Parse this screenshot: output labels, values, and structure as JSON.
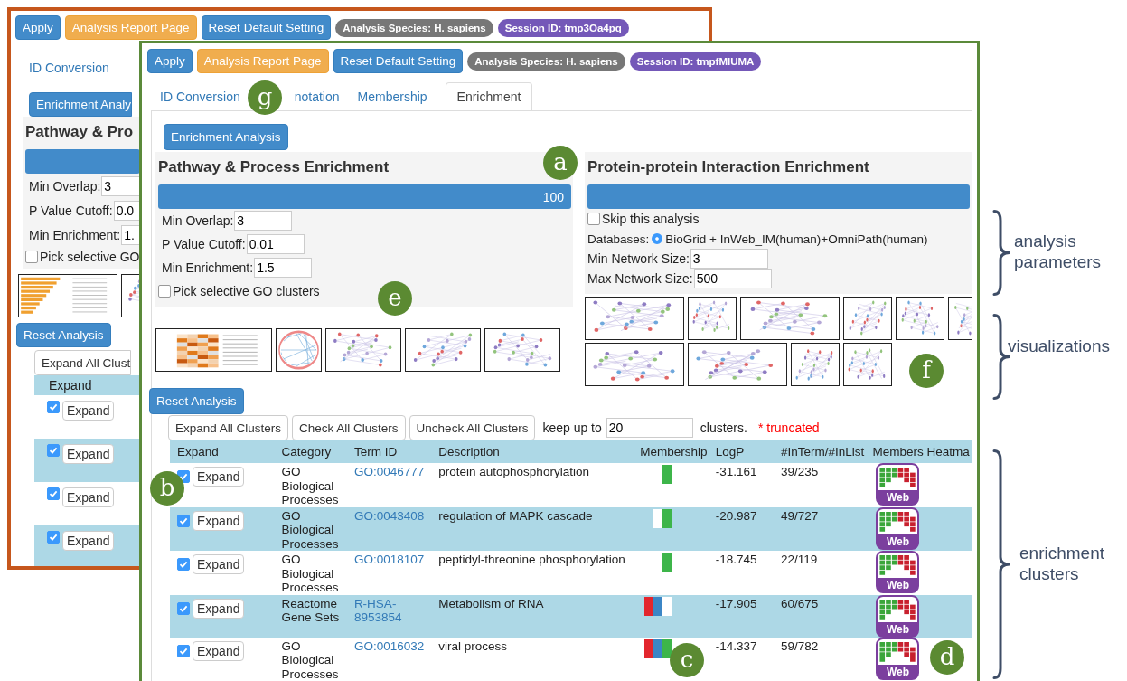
{
  "back_window": {
    "toolbar": {
      "buttons": [
        {
          "label": "Apply",
          "kind": "primary"
        },
        {
          "label": "Analysis Report Page",
          "kind": "warning"
        },
        {
          "label": "Reset Default Setting",
          "kind": "primary"
        }
      ],
      "badges": [
        {
          "label": "Analysis Species: H. sapiens",
          "color": "#777777"
        },
        {
          "label": "Session ID: tmp3Oa4pq",
          "color": "#7458b8"
        }
      ]
    },
    "tabs": [
      {
        "label": "ID Conversion",
        "selected": false
      }
    ],
    "enrichment_button": "Enrichment Analy",
    "heading": "Pathway & Pro",
    "progress": {
      "level": 1
    },
    "fields": [
      {
        "label": "Min Overlap:",
        "value": "3"
      },
      {
        "label": "P Value Cutoff:",
        "value": "0.0"
      },
      {
        "label": "Min Enrichment:",
        "value": "1."
      }
    ],
    "pick_clusters": {
      "label": "Pick selective GO",
      "checked": false
    },
    "thumbnails": [
      {
        "kind": "bar"
      },
      {
        "kind": "network"
      }
    ],
    "reset_button": "Reset Analysis",
    "expand_all_button": "Expand All Clust",
    "table": {
      "columns": [
        "Expand"
      ],
      "rows": [
        {
          "checked": true,
          "button": "Expand"
        },
        {
          "checked": true,
          "button": "Expand"
        },
        {
          "checked": true,
          "button": "Expand"
        },
        {
          "checked": true,
          "button": "Expand"
        }
      ]
    }
  },
  "front_window": {
    "toolbar": {
      "buttons": [
        {
          "label": "Apply",
          "kind": "primary"
        },
        {
          "label": "Analysis Report Page",
          "kind": "warning"
        },
        {
          "label": "Reset Default Setting",
          "kind": "primary"
        }
      ],
      "badges": [
        {
          "label": "Analysis Species: H. sapiens",
          "color": "#777777"
        },
        {
          "label": "Session ID: tmpfMIUMA",
          "color": "#7458b8"
        }
      ]
    },
    "tabs": [
      {
        "label": "ID Conversion",
        "selected": false
      },
      {
        "label": "notation",
        "selected": false
      },
      {
        "label": "Membership",
        "selected": false
      },
      {
        "label": "Enrichment",
        "selected": true
      }
    ],
    "enrichment_button": "Enrichment Analysis",
    "pathway_panel": {
      "heading": "Pathway & Process Enrichment",
      "progress": {
        "level": 1,
        "reading": "100"
      },
      "fields": [
        {
          "label": "Min Overlap:",
          "value": "3"
        },
        {
          "label": "P Value Cutoff:",
          "value": "0.01"
        },
        {
          "label": "Min Enrichment:",
          "value": "1.5"
        }
      ],
      "pick_clusters": {
        "label": "Pick selective GO clusters",
        "checked": false
      },
      "thumbnails": [
        {
          "kind": "heatmap"
        },
        {
          "kind": "circos"
        },
        {
          "kind": "network"
        },
        {
          "kind": "network"
        },
        {
          "kind": "network"
        }
      ]
    },
    "ppi_panel": {
      "heading": "Protein-protein Interaction Enrichment",
      "progress": {
        "level": 1
      },
      "skip": {
        "label": "Skip this analysis",
        "checked": false
      },
      "databases": {
        "label": "Databases:",
        "options": [
          {
            "label": "BioGrid + InWeb_IM(human)+OmniPath(human)",
            "selected": true
          }
        ]
      },
      "fields": [
        {
          "label": "Min Network Size:",
          "value": "3"
        },
        {
          "label": "Max Network Size:",
          "value": "500"
        }
      ],
      "thumbnail_rows": [
        [
          {
            "kind": "network"
          },
          {
            "kind": "cluster"
          },
          {
            "kind": "network"
          },
          {
            "kind": "cluster"
          },
          {
            "kind": "cluster"
          },
          {
            "kind": "cluster"
          }
        ],
        [
          {
            "kind": "network"
          },
          {
            "kind": "network"
          },
          {
            "kind": "cluster"
          },
          {
            "kind": "cluster"
          }
        ]
      ]
    },
    "reset_button": "Reset Analysis",
    "cluster_buttons": [
      "Expand All Clusters",
      "Check All Clusters",
      "Uncheck All Clusters"
    ],
    "keep": {
      "prefix": "keep up to",
      "value": "20",
      "suffix": "clusters.",
      "note": "* truncated"
    },
    "table": {
      "columns": [
        "Expand",
        "Category",
        "Term ID",
        "Description",
        "Membership",
        "LogP",
        "#InTerm/#InList",
        "Members Heatma"
      ],
      "rows": [
        {
          "checked": true,
          "button": "Expand",
          "category": "GO Biological Processes",
          "term_id": "GO:0046777",
          "description": "protein autophosphorylation",
          "membership": [
            {
              "color": "#3db54a"
            }
          ],
          "logp": "-31.161",
          "counts": "39/235",
          "heatmap": "Web"
        },
        {
          "checked": true,
          "button": "Expand",
          "category": "GO Biological Processes",
          "term_id": "GO:0043408",
          "description": "regulation of MAPK cascade",
          "membership": [
            {
              "color": "#ffffff"
            },
            {
              "color": "#3db54a"
            }
          ],
          "logp": "-20.987",
          "counts": "49/727",
          "heatmap": "Web"
        },
        {
          "checked": true,
          "button": "Expand",
          "category": "GO Biological Processes",
          "term_id": "GO:0018107",
          "description": "peptidyl-threonine phosphorylation",
          "membership": [
            {
              "color": "#3db54a"
            }
          ],
          "logp": "-18.745",
          "counts": "22/119",
          "heatmap": "Web"
        },
        {
          "checked": true,
          "button": "Expand",
          "category": "Reactome Gene Sets",
          "term_id": "R-HSA-8953854",
          "description": "Metabolism of RNA",
          "membership": [
            {
              "color": "#e3262d"
            },
            {
              "color": "#3b86c6"
            },
            {
              "color": "#ffffff"
            }
          ],
          "logp": "-17.905",
          "counts": "60/675",
          "heatmap": "Web"
        },
        {
          "checked": true,
          "button": "Expand",
          "category": "GO Biological Processes",
          "term_id": "GO:0016032",
          "description": "viral process",
          "membership": [
            {
              "color": "#e3262d"
            },
            {
              "color": "#3b86c6"
            },
            {
              "color": "#3db54a"
            }
          ],
          "logp": "-14.337",
          "counts": "59/782",
          "heatmap": "Web"
        }
      ]
    }
  },
  "markers": [
    {
      "letter": "a"
    },
    {
      "letter": "b"
    },
    {
      "letter": "c"
    },
    {
      "letter": "d"
    },
    {
      "letter": "e"
    },
    {
      "letter": "f"
    },
    {
      "letter": "g"
    }
  ],
  "braces": [
    {
      "label": "analysis parameters"
    },
    {
      "label": "visualizations"
    },
    {
      "label": "enrichment clusters"
    }
  ]
}
